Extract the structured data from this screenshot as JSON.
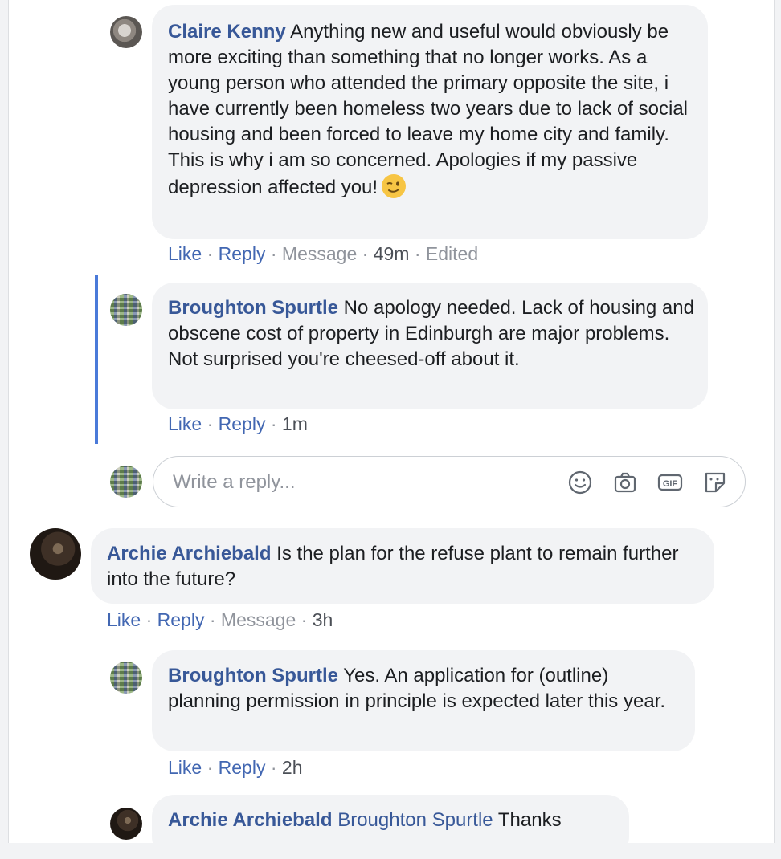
{
  "comments": {
    "claire": {
      "author": "Claire Kenny",
      "text": " Anything new and useful would obviously be more exciting than something that no longer works. As a young person who attended the primary opposite the site, i have currently been homeless two years due to lack of social housing and been forced to leave my home city and family. This is why i am so concerned. Apologies if my passive depression affected you!",
      "emoji": "winking-face",
      "like": "Like",
      "reply": "Reply",
      "message": "Message",
      "time": "49m",
      "edited": "Edited"
    },
    "broughton_1": {
      "author": "Broughton Spurtle",
      "text": " No apology needed. Lack of housing and obscene cost of property in Edinburgh are major problems. Not surprised you're cheesed-off about it.",
      "like": "Like",
      "reply": "Reply",
      "time": "1m"
    },
    "archie": {
      "author": "Archie Archiebald",
      "text": " Is the plan for the refuse plant to remain further into the future?",
      "like": "Like",
      "reply": "Reply",
      "message": "Message",
      "time": "3h"
    },
    "broughton_2": {
      "author": "Broughton Spurtle",
      "text": " Yes. An application for (outline) planning permission in principle is expected later this year.",
      "like": "Like",
      "reply": "Reply",
      "time": "2h"
    },
    "archie_2": {
      "author": "Archie Archiebald",
      "mention": "Broughton Spurtle",
      "text": " Thanks"
    }
  },
  "reply_box": {
    "placeholder": "Write a reply...",
    "icons": [
      "emoji-icon",
      "camera-icon",
      "gif-icon",
      "sticker-icon"
    ]
  },
  "colors": {
    "author": "#385898",
    "link": "#4267b2",
    "meta": "#90949c",
    "bubble": "#f2f3f5",
    "thread_line": "#4a7ad9"
  }
}
